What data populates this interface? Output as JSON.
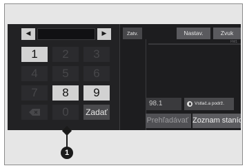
{
  "keypad": {
    "prev_icon": "left-arrow-icon",
    "next_icon": "right-arrow-icon",
    "prev_glyph": "◀",
    "next_glyph": "▶",
    "keys": {
      "k1": "1",
      "k2": "2",
      "k3": "3",
      "k4": "4",
      "k5": "5",
      "k6": "6",
      "k7": "7",
      "k8": "8",
      "k9": "9",
      "k0": "0"
    },
    "backspace_icon": "backspace-icon",
    "enter_label": "Zadať"
  },
  "header": {
    "close_label": "Zatv.",
    "settings_label": "Nastav.",
    "sound_label": "Zvuk"
  },
  "radio": {
    "mini_label": "FM1",
    "frequency": "98.1",
    "store_label": "Vstlač.a podrž.",
    "store_icon": "store-icon",
    "search_label": "Prehľadávať",
    "station_list_label": "Zoznam staníc"
  },
  "callout": {
    "number": "1"
  },
  "colors": {
    "screen_bg": "#1d1d1f",
    "active_key": "#d2d2d2",
    "inactive_key": "#2b2b2e",
    "button_bg": "#5a5a5e",
    "callout": "#1a1a1a"
  }
}
